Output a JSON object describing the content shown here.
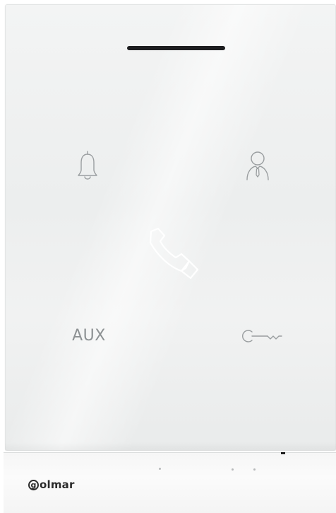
{
  "device": {
    "buttons": [
      {
        "id": "bell",
        "icon": "bell-icon"
      },
      {
        "id": "concierge",
        "icon": "user-icon"
      },
      {
        "id": "call",
        "icon": "phone-handset-icon"
      },
      {
        "id": "aux",
        "label": "AUX"
      },
      {
        "id": "door_release",
        "icon": "key-icon"
      }
    ],
    "brand": {
      "initial": "g",
      "rest": "olmar"
    }
  },
  "colors": {
    "icon_gray": "#9a9ea0",
    "call_icon": "#ffffff",
    "slot": "#1d1d1f",
    "logo": "#2b2b2b"
  }
}
